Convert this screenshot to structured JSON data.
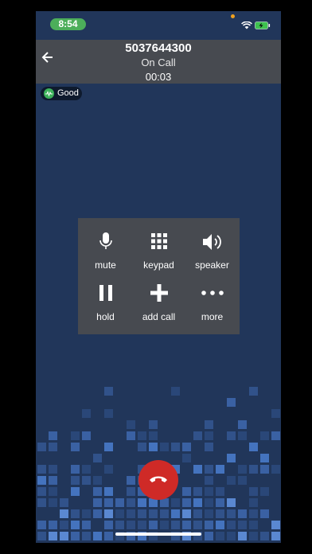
{
  "status": {
    "time": "8:54"
  },
  "call": {
    "number": "5037644300",
    "state": "On Call",
    "duration": "00:03",
    "quality": "Good"
  },
  "controls": [
    {
      "id": "mute",
      "label": "mute",
      "icon": "microphone-icon"
    },
    {
      "id": "keypad",
      "label": "keypad",
      "icon": "keypad-icon"
    },
    {
      "id": "speaker",
      "label": "speaker",
      "icon": "speaker-icon"
    },
    {
      "id": "hold",
      "label": "hold",
      "icon": "pause-icon"
    },
    {
      "id": "add-call",
      "label": "add call",
      "icon": "plus-icon"
    },
    {
      "id": "more",
      "label": "more",
      "icon": "ellipsis-icon"
    }
  ],
  "colors": {
    "background": "#21365a",
    "callbar": "#474a50",
    "hangup": "#cf2a27",
    "quality": "#3cb15a",
    "status_time": "#4cae5a"
  }
}
